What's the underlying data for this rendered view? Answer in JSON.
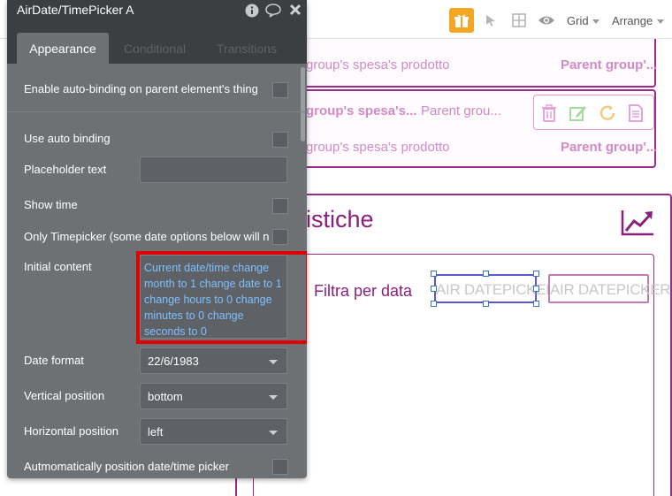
{
  "toolbar": {
    "grid_label": "Grid",
    "arrange_label": "Arrange",
    "icons": [
      "gift-icon",
      "pointer-icon",
      "layout-grid-icon",
      "eye-icon"
    ],
    "accent": "#f5a623"
  },
  "panel": {
    "title": "AirDate/TimePicker A",
    "tabs": [
      {
        "label": "Appearance",
        "active": true
      },
      {
        "label": "Conditional",
        "active": false
      },
      {
        "label": "Transitions",
        "active": false
      }
    ],
    "enable_autobinding_label": "Enable auto-binding on parent element's thing",
    "use_auto_binding_label": "Use auto binding",
    "placeholder_label": "Placeholder text",
    "placeholder_value": "",
    "show_time_label": "Show time",
    "only_timepicker_label": "Only Timepicker (some date options below will n",
    "initial_content_label": "Initial content",
    "initial_content_value": "Current date/time change month to 1 change date to 1 change hours to 0 change minutes to 0 change seconds to 0",
    "date_format_label": "Date format",
    "date_format_value": "22/6/1983",
    "vertical_position_label": "Vertical position",
    "vertical_position_value": "bottom",
    "horizontal_position_label": "Horizontal position",
    "horizontal_position_value": "left",
    "auto_position_label": "Autmomatically position date/time picker"
  },
  "canvas": {
    "row1_text": "group's spesa's prodotto",
    "row1_parent": "Parent group'...",
    "row2_spesa": "group's spesa's...",
    "row2_parent": "Parent grou...",
    "row3_text": "group's spesa's prodotto",
    "row3_parent": "Parent group'...",
    "stat_title": "istiche",
    "filtra_label": "Filtra per data",
    "datepicker1_text": "AIR DATEPICKER",
    "datepicker2_text": "AIR DATEPICKER",
    "brand_color": "#9b2c8d"
  }
}
